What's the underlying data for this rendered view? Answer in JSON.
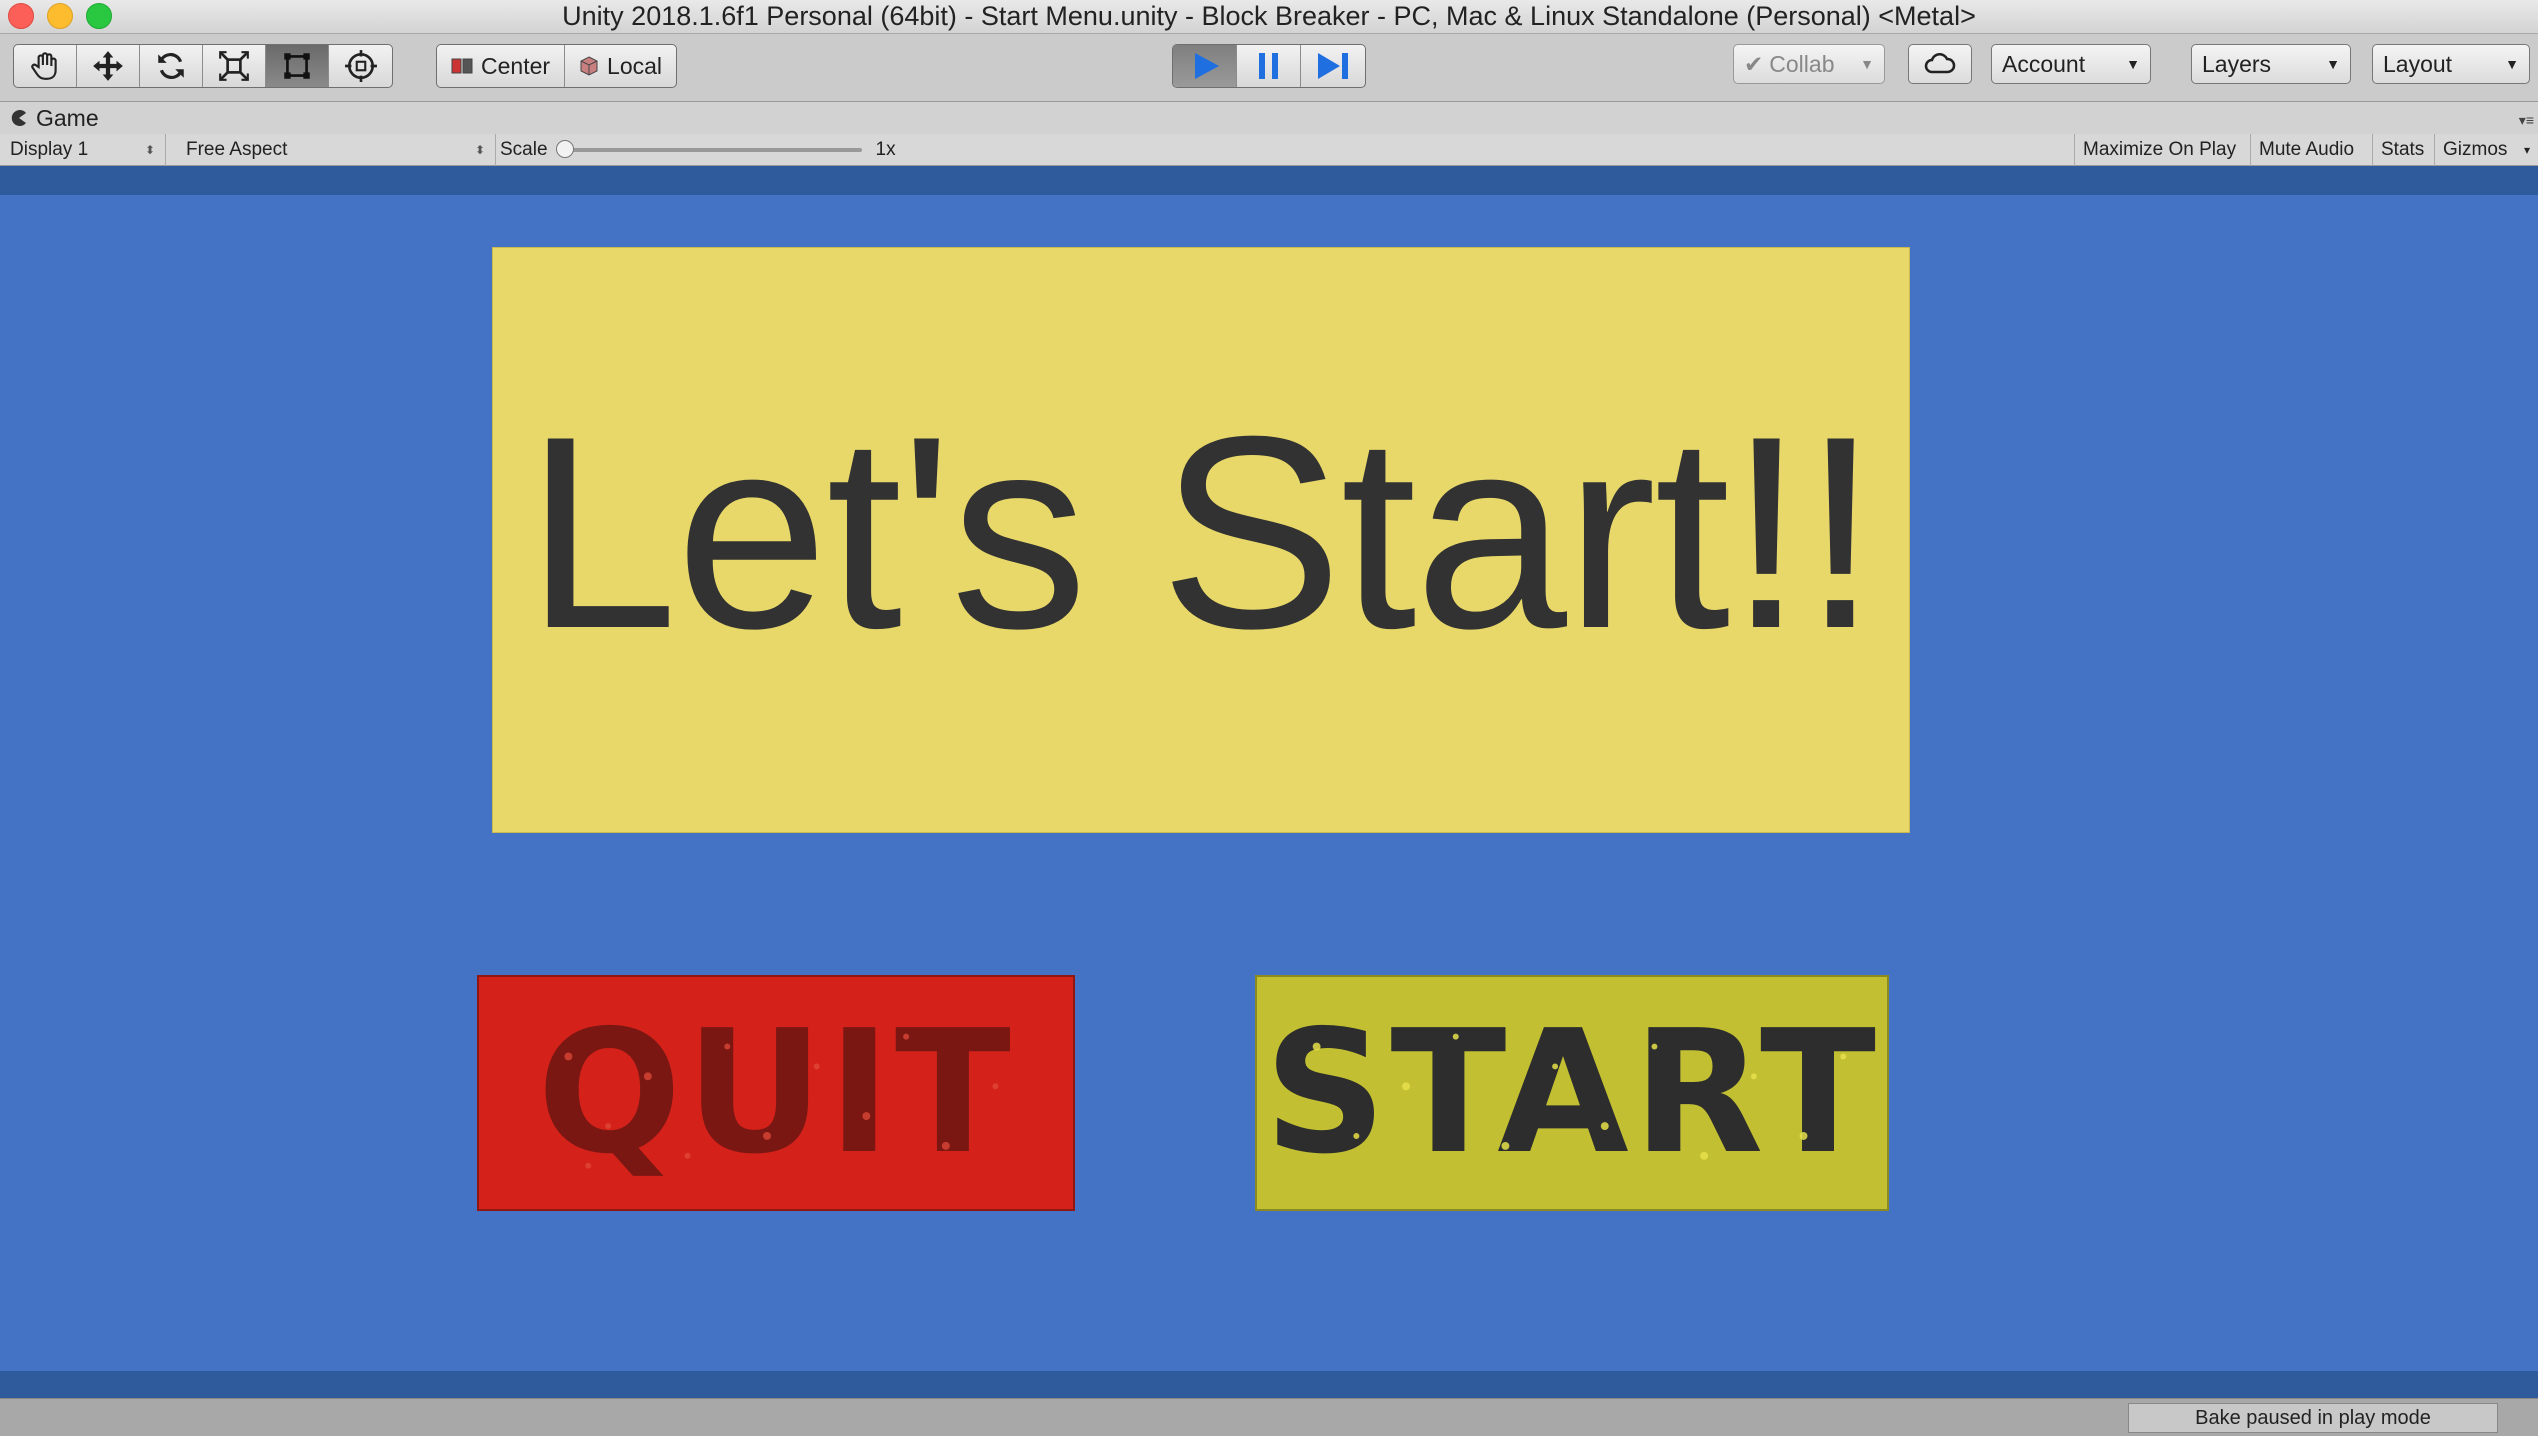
{
  "window": {
    "title": "Unity 2018.1.6f1 Personal (64bit) - Start Menu.unity - Block Breaker - PC, Mac & Linux Standalone (Personal) <Metal>"
  },
  "toolbar": {
    "tools": [
      "hand-tool",
      "move-tool",
      "rotate-tool",
      "scale-tool",
      "rect-tool",
      "transform-tool"
    ],
    "active_tool": "rect-tool",
    "pivot_label": "Center",
    "space_label": "Local",
    "play_state": "playing",
    "collab_label": "Collab",
    "account_label": "Account",
    "layers_label": "Layers",
    "layout_label": "Layout"
  },
  "game_panel": {
    "tab_label": "Game",
    "display_label": "Display 1",
    "aspect_label": "Free Aspect",
    "scale_label": "Scale",
    "scale_value": "1x",
    "maximize_label": "Maximize On Play",
    "mute_label": "Mute Audio",
    "stats_label": "Stats",
    "gizmos_label": "Gizmos"
  },
  "scene": {
    "heading": "Let's Start!!",
    "quit_label": "QUIT",
    "start_label": "START",
    "colors": {
      "background": "#4472c4",
      "heading_panel": "#e8d86a",
      "quit_button": "#d4211a",
      "start_button": "#c2c032"
    }
  },
  "status": {
    "message": "Bake paused in play mode"
  }
}
